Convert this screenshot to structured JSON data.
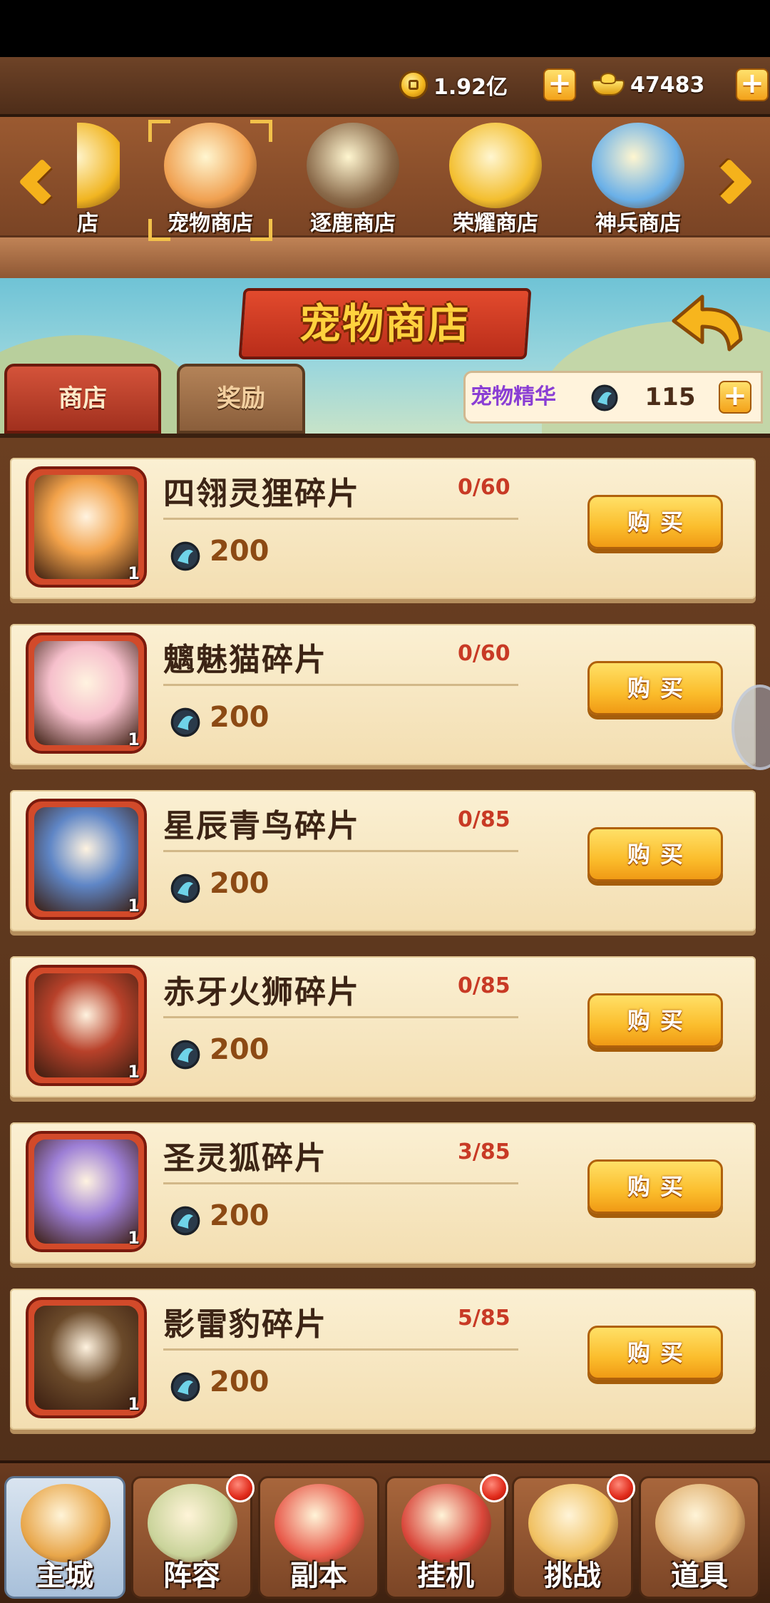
{
  "colors": {
    "accent_gold": "#f5b21b",
    "count_red": "#c83a25",
    "essence_purple": "#8a3ed4",
    "panel_brown": "#5b3520",
    "card_cream": "#f8e9c6"
  },
  "resources": {
    "gold": {
      "icon": "gold-coin-icon",
      "value": "1.92亿"
    },
    "ingot": {
      "icon": "gold-ingot-icon",
      "value": "47483"
    }
  },
  "shop_tabs": [
    {
      "label": "商店",
      "icon": "coin-shop-icon",
      "selected": false
    },
    {
      "label": "宠物商店",
      "icon": "corgi-pet-icon",
      "selected": true
    },
    {
      "label": "逐鹿商店",
      "icon": "treasure-chest-icon",
      "selected": false
    },
    {
      "label": "荣耀商店",
      "icon": "honor-medal-icon",
      "selected": false
    },
    {
      "label": "神兵商店",
      "icon": "divine-sword-icon",
      "selected": false
    }
  ],
  "banner": {
    "title": "宠物商店"
  },
  "sub_tabs": {
    "shop": "商店",
    "reward": "奖励"
  },
  "essence": {
    "label": "宠物精华",
    "icon": "pet-essence-icon",
    "value": "115"
  },
  "items": [
    {
      "name": "四翎灵狸碎片",
      "count": "0/60",
      "cost": "200",
      "qty": "1",
      "portrait": "raccoon-pet-portrait",
      "frame_color": "#d24a2a",
      "art": "#f2a24a"
    },
    {
      "name": "魑魅猫碎片",
      "count": "0/60",
      "cost": "200",
      "qty": "1",
      "portrait": "pink-cat-pet-portrait",
      "frame_color": "#d24a2a",
      "art": "#f6c0cc"
    },
    {
      "name": "星辰青鸟碎片",
      "count": "0/85",
      "cost": "200",
      "qty": "1",
      "portrait": "blue-bird-pet-portrait",
      "frame_color": "#d24a2a",
      "art": "#5f86c6"
    },
    {
      "name": "赤牙火狮碎片",
      "count": "0/85",
      "cost": "200",
      "qty": "1",
      "portrait": "fire-lion-pet-portrait",
      "frame_color": "#d24a2a",
      "art": "#b8412a"
    },
    {
      "name": "圣灵狐碎片",
      "count": "3/85",
      "cost": "200",
      "qty": "1",
      "portrait": "purple-fox-pet-portrait",
      "frame_color": "#d24a2a",
      "art": "#9d7fd6"
    },
    {
      "name": "影雷豹碎片",
      "count": "5/85",
      "cost": "200",
      "qty": "1",
      "portrait": "shadow-leopard-pet-portrait",
      "frame_color": "#d24a2a",
      "art": "#6b4a2a"
    }
  ],
  "buy_label": "购买",
  "nav": [
    {
      "label": "主城",
      "icon": "main-city-icon",
      "active": true,
      "badge": false,
      "art": "#e8a64a"
    },
    {
      "label": "阵容",
      "icon": "lineup-icon",
      "active": false,
      "badge": true,
      "art": "#c9d39a"
    },
    {
      "label": "副本",
      "icon": "dungeon-icon",
      "active": false,
      "badge": false,
      "art": "#e85a4a"
    },
    {
      "label": "挂机",
      "icon": "idle-bag-icon",
      "active": false,
      "badge": true,
      "art": "#d9463a"
    },
    {
      "label": "挑战",
      "icon": "challenge-icon",
      "active": false,
      "badge": true,
      "art": "#f0c060"
    },
    {
      "label": "道具",
      "icon": "items-pouch-icon",
      "active": false,
      "badge": false,
      "art": "#e0b070"
    }
  ]
}
